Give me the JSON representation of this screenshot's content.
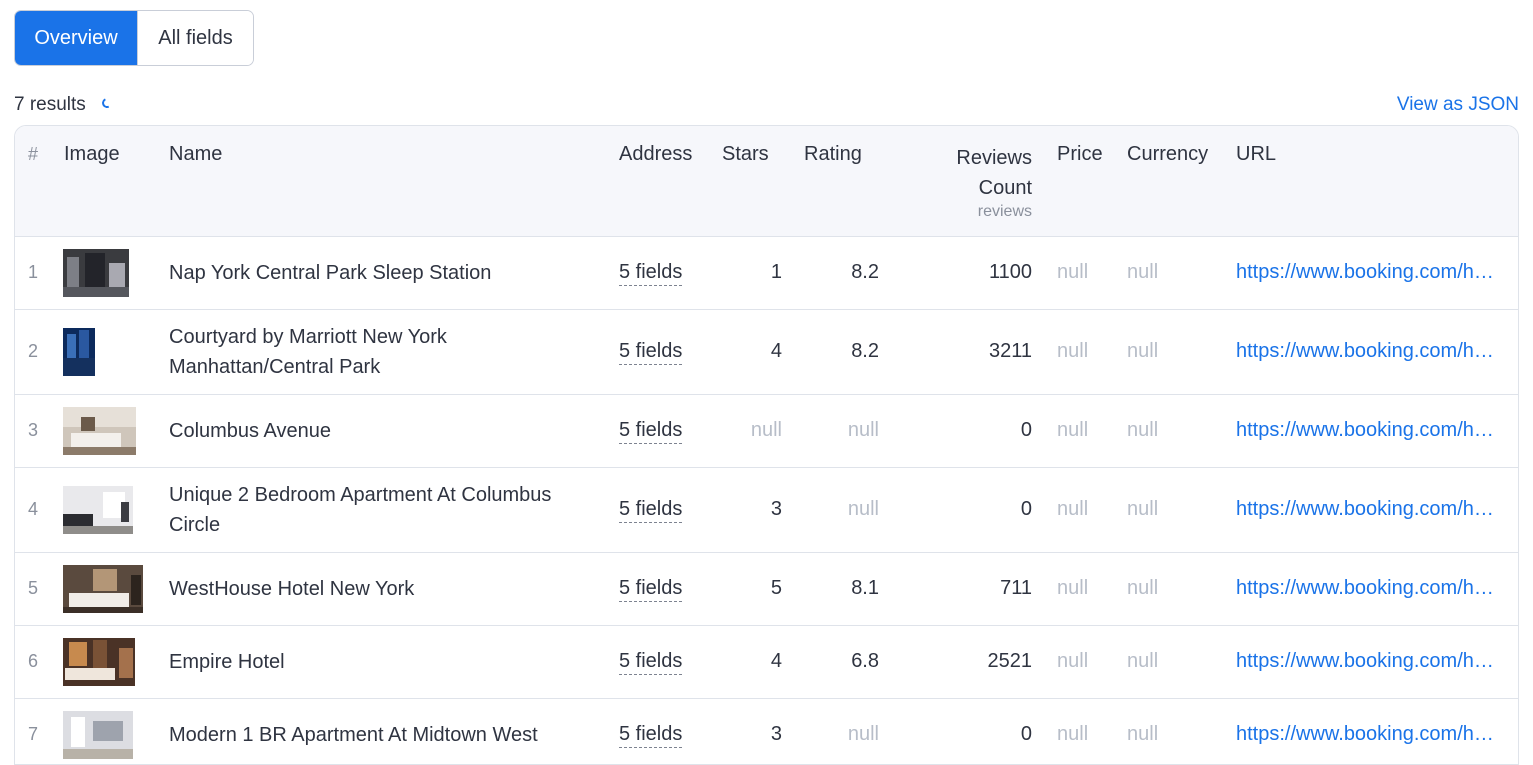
{
  "tabs": [
    {
      "label": "Overview",
      "active": true
    },
    {
      "label": "All fields",
      "active": false
    }
  ],
  "results_text": "7 results",
  "view_json_label": "View as JSON",
  "columns": {
    "num": "#",
    "image": "Image",
    "name": "Name",
    "address": "Address",
    "stars": "Stars",
    "rating": "Rating",
    "reviews_count": "Reviews Count",
    "reviews_count_sub": "reviews",
    "price": "Price",
    "currency": "Currency",
    "url": "URL"
  },
  "rows": [
    {
      "num": "1",
      "name": "Nap York Central Park Sleep Station",
      "address": "5 fields",
      "stars": "1",
      "rating": "8.2",
      "reviews_count": "1100",
      "price": "null",
      "currency": "null",
      "url": "https://www.booking.com/hot..."
    },
    {
      "num": "2",
      "name": "Courtyard by Marriott New York Manhattan/Central Park",
      "address": "5 fields",
      "stars": "4",
      "rating": "8.2",
      "reviews_count": "3211",
      "price": "null",
      "currency": "null",
      "url": "https://www.booking.com/hot..."
    },
    {
      "num": "3",
      "name": "Columbus Avenue",
      "address": "5 fields",
      "stars": "null",
      "rating": "null",
      "reviews_count": "0",
      "price": "null",
      "currency": "null",
      "url": "https://www.booking.com/hot..."
    },
    {
      "num": "4",
      "name": "Unique 2 Bedroom Apartment At Columbus Circle",
      "address": "5 fields",
      "stars": "3",
      "rating": "null",
      "reviews_count": "0",
      "price": "null",
      "currency": "null",
      "url": "https://www.booking.com/hot..."
    },
    {
      "num": "5",
      "name": "WestHouse Hotel New York",
      "address": "5 fields",
      "stars": "5",
      "rating": "8.1",
      "reviews_count": "711",
      "price": "null",
      "currency": "null",
      "url": "https://www.booking.com/hot..."
    },
    {
      "num": "6",
      "name": "Empire Hotel",
      "address": "5 fields",
      "stars": "4",
      "rating": "6.8",
      "reviews_count": "2521",
      "price": "null",
      "currency": "null",
      "url": "https://www.booking.com/hot..."
    },
    {
      "num": "7",
      "name": "Modern 1 BR Apartment At Midtown West",
      "address": "5 fields",
      "stars": "3",
      "rating": "null",
      "reviews_count": "0",
      "price": "null",
      "currency": "null",
      "url": "https://www.booking.com/hot..."
    }
  ],
  "colors": {
    "accent": "#1a73e8",
    "null_text": "#b7bdc8",
    "header_bg": "#f6f7fb"
  }
}
